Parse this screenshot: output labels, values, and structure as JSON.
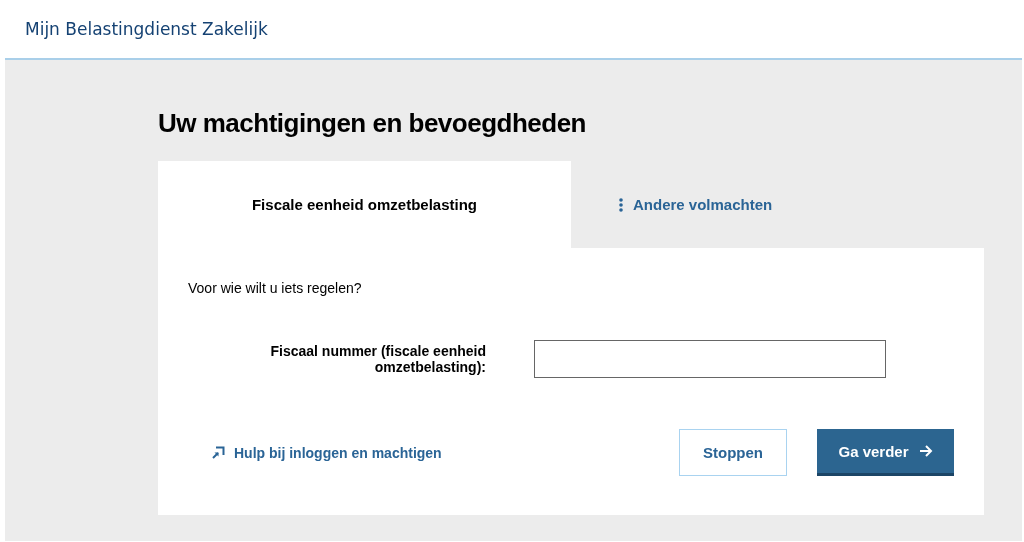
{
  "header": {
    "title": "Mijn Belastingdienst Zakelijk"
  },
  "page_title": "Uw machtigingen en bevoegdheden",
  "tabs": [
    {
      "label": "Fiscale eenheid omzetbelasting",
      "selected": true
    },
    {
      "label": "Andere volmachten",
      "selected": false
    }
  ],
  "question": "Voor wie wilt u iets regelen?",
  "field": {
    "label": "Fiscaal nummer (fiscale eenheid omzetbelasting):"
  },
  "help_link": "Hulp bij inloggen en machtigen",
  "buttons": [
    {
      "label": "Stoppen",
      "kind": "secondary"
    },
    {
      "label": "Ga verder",
      "kind": "primary"
    }
  ]
}
